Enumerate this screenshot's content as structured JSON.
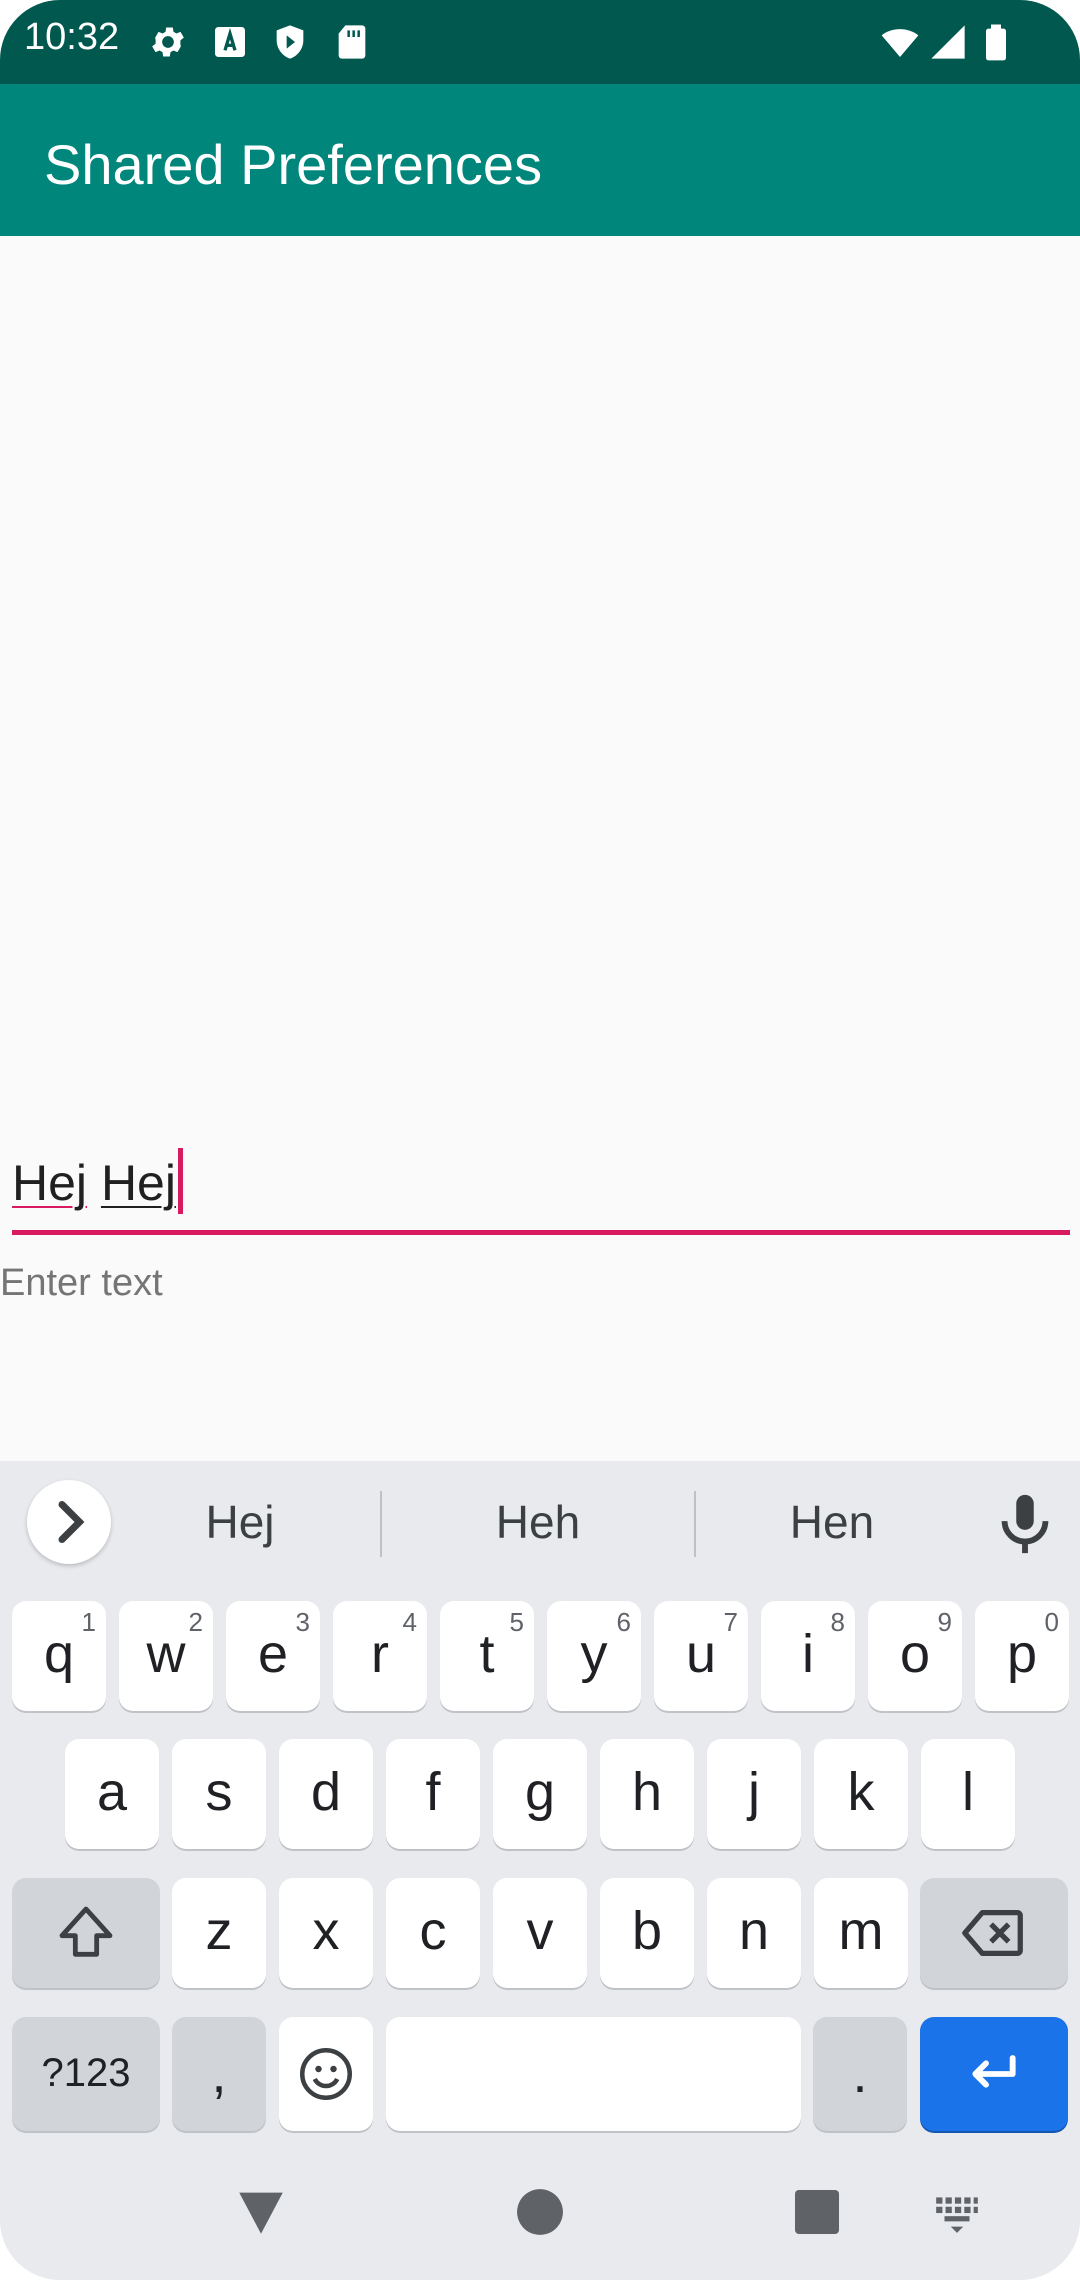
{
  "status_bar": {
    "time": "10:32"
  },
  "app_bar": {
    "title": "Shared Preferences"
  },
  "edit_field": {
    "word1": "Hej",
    "word2": "Hej",
    "helper_text": "Enter text"
  },
  "keyboard": {
    "suggestions": [
      "Hej",
      "Heh",
      "Hen"
    ],
    "row1": [
      {
        "label": "q",
        "hint": "1"
      },
      {
        "label": "w",
        "hint": "2"
      },
      {
        "label": "e",
        "hint": "3"
      },
      {
        "label": "r",
        "hint": "4"
      },
      {
        "label": "t",
        "hint": "5"
      },
      {
        "label": "y",
        "hint": "6"
      },
      {
        "label": "u",
        "hint": "7"
      },
      {
        "label": "i",
        "hint": "8"
      },
      {
        "label": "o",
        "hint": "9"
      },
      {
        "label": "p",
        "hint": "0"
      }
    ],
    "row2": [
      "a",
      "s",
      "d",
      "f",
      "g",
      "h",
      "j",
      "k",
      "l"
    ],
    "row3": [
      "z",
      "x",
      "c",
      "v",
      "b",
      "n",
      "m"
    ],
    "symbols_key": "?123",
    "comma_key": ",",
    "period_key": ".",
    "icons": [
      "chevron-right-icon",
      "mic-icon",
      "shift-icon",
      "backspace-icon",
      "emoji-icon",
      "enter-icon",
      "keyboard-icon"
    ]
  },
  "colors": {
    "status_bar": "#00584f",
    "app_bar": "#00867a",
    "accent": "#d81b60",
    "enter_key": "#1a73e8"
  }
}
